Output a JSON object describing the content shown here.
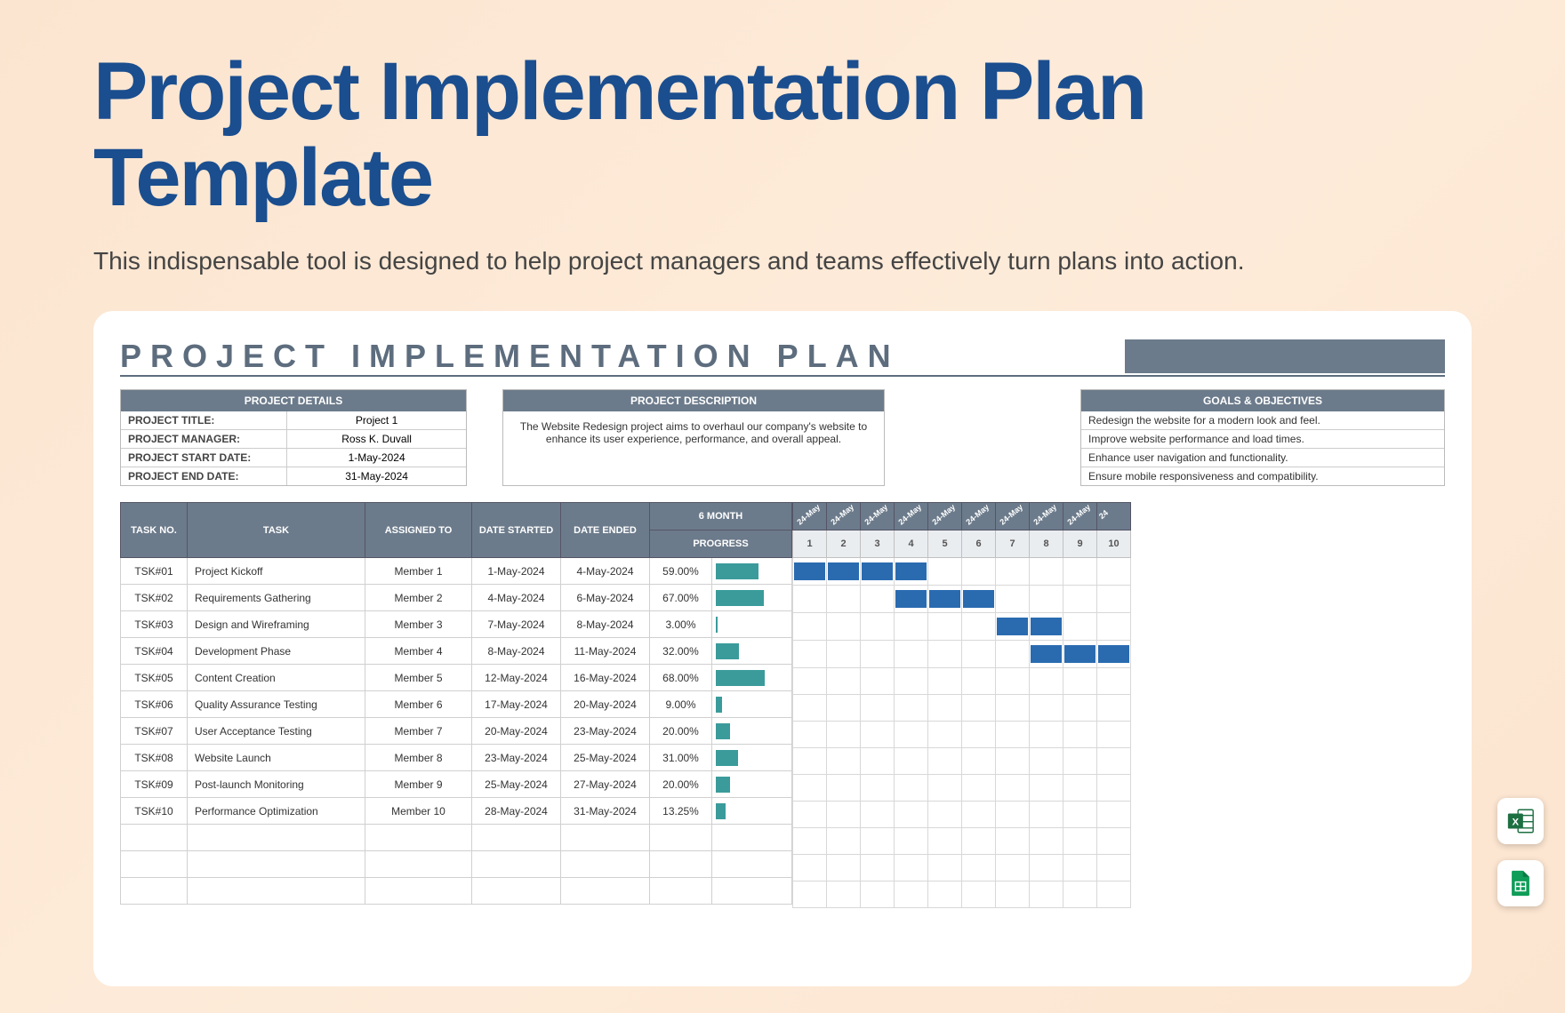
{
  "page": {
    "title": "Project Implementation Plan Template",
    "subtitle": "This indispensable tool is designed to help project managers and teams effectively turn plans into action."
  },
  "plan": {
    "heading": "PROJECT IMPLEMENTATION PLAN",
    "details_header": "PROJECT DETAILS",
    "desc_header": "PROJECT DESCRIPTION",
    "goals_header": "GOALS & OBJECTIVES",
    "details": {
      "title_label": "PROJECT TITLE:",
      "title_value": "Project 1",
      "manager_label": "PROJECT MANAGER:",
      "manager_value": "Ross K. Duvall",
      "start_label": "PROJECT START DATE:",
      "start_value": "1-May-2024",
      "end_label": "PROJECT END DATE:",
      "end_value": "31-May-2024"
    },
    "description": "The Website Redesign project aims to overhaul our company's website to enhance its user experience, performance, and overall appeal.",
    "goals": [
      "Redesign the website for a modern look and feel.",
      "Improve website performance and load times.",
      "Enhance user navigation and functionality.",
      "Ensure mobile responsiveness and compatibility."
    ]
  },
  "table": {
    "headers": {
      "task_no": "TASK NO.",
      "task": "TASK",
      "assigned": "ASSIGNED TO",
      "start": "DATE STARTED",
      "end": "DATE ENDED",
      "period": "6 MONTH",
      "progress": "PROGRESS"
    },
    "gantt_dates": [
      "24-May",
      "24-May",
      "24-May",
      "24-May",
      "24-May",
      "24-May",
      "24-May",
      "24-May",
      "24-May",
      "24"
    ],
    "gantt_nums": [
      "1",
      "2",
      "3",
      "4",
      "5",
      "6",
      "7",
      "8",
      "9",
      "10"
    ],
    "rows": [
      {
        "no": "TSK#01",
        "task": "Project Kickoff",
        "assigned": "Member 1",
        "start": "1-May-2024",
        "end": "4-May-2024",
        "pct": "59.00%",
        "bar": 59,
        "gstart": 1,
        "gend": 4
      },
      {
        "no": "TSK#02",
        "task": "Requirements Gathering",
        "assigned": "Member 2",
        "start": "4-May-2024",
        "end": "6-May-2024",
        "pct": "67.00%",
        "bar": 67,
        "gstart": 4,
        "gend": 6
      },
      {
        "no": "TSK#03",
        "task": "Design and Wireframing",
        "assigned": "Member 3",
        "start": "7-May-2024",
        "end": "8-May-2024",
        "pct": "3.00%",
        "bar": 3,
        "gstart": 7,
        "gend": 8
      },
      {
        "no": "TSK#04",
        "task": "Development Phase",
        "assigned": "Member 4",
        "start": "8-May-2024",
        "end": "11-May-2024",
        "pct": "32.00%",
        "bar": 32,
        "gstart": 8,
        "gend": 10
      },
      {
        "no": "TSK#05",
        "task": "Content Creation",
        "assigned": "Member 5",
        "start": "12-May-2024",
        "end": "16-May-2024",
        "pct": "68.00%",
        "bar": 68,
        "gstart": 0,
        "gend": 0
      },
      {
        "no": "TSK#06",
        "task": "Quality Assurance Testing",
        "assigned": "Member 6",
        "start": "17-May-2024",
        "end": "20-May-2024",
        "pct": "9.00%",
        "bar": 9,
        "gstart": 0,
        "gend": 0
      },
      {
        "no": "TSK#07",
        "task": "User Acceptance Testing",
        "assigned": "Member 7",
        "start": "20-May-2024",
        "end": "23-May-2024",
        "pct": "20.00%",
        "bar": 20,
        "gstart": 0,
        "gend": 0
      },
      {
        "no": "TSK#08",
        "task": "Website Launch",
        "assigned": "Member 8",
        "start": "23-May-2024",
        "end": "25-May-2024",
        "pct": "31.00%",
        "bar": 31,
        "gstart": 0,
        "gend": 0
      },
      {
        "no": "TSK#09",
        "task": "Post-launch Monitoring",
        "assigned": "Member 9",
        "start": "25-May-2024",
        "end": "27-May-2024",
        "pct": "20.00%",
        "bar": 20,
        "gstart": 0,
        "gend": 0
      },
      {
        "no": "TSK#10",
        "task": "Performance Optimization",
        "assigned": "Member 10",
        "start": "28-May-2024",
        "end": "31-May-2024",
        "pct": "13.25%",
        "bar": 13,
        "gstart": 0,
        "gend": 0
      }
    ],
    "empty_rows": 3
  },
  "icons": {
    "excel": "Excel",
    "sheets": "Google Sheets"
  }
}
